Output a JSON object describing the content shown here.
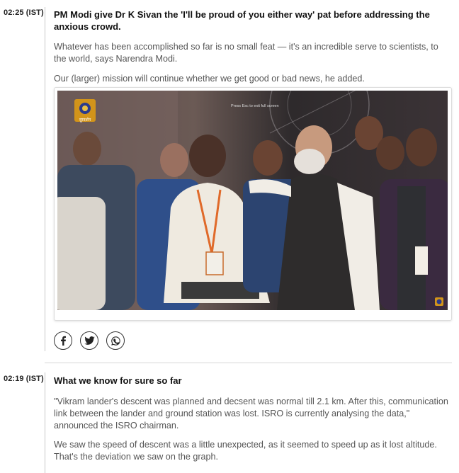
{
  "entries": [
    {
      "time": "02:25 (IST)",
      "headline": "PM Modi give Dr K Sivan the 'I'll be proud of you either way' pat before addressing the anxious crowd.",
      "paragraphs": [
        "Whatever has been accomplished so far is no small feat — it's an incredible serve to scientists, to the world, says Narendra Modi.",
        "Our (larger) mission will continue whether we get good or bad news, he added."
      ],
      "image": {
        "overlay_text": "Press Esc to exit full screen",
        "channel_logo_text": "दूरदर्शन"
      },
      "share": [
        "facebook-icon",
        "twitter-icon",
        "whatsapp-icon"
      ]
    },
    {
      "time": "02:19 (IST)",
      "headline": "What we know for sure so far",
      "paragraphs": [
        "\"Vikram lander's descent was planned and decsent was normal till 2.1 km. After this, communication link between the lander and ground station was lost. ISRO is currently analysing the data,\" announced the ISRO chairman.",
        "We saw the speed of descent was a little unexpected, as it seemed to speed up as it lost altitude. That's the deviation we saw on the graph."
      ]
    }
  ]
}
